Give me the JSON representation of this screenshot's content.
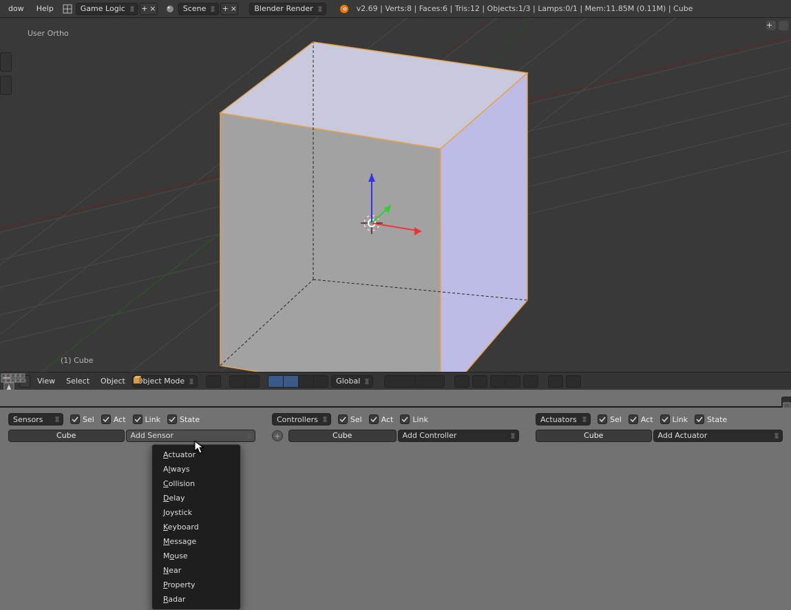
{
  "top": {
    "menus": [
      "dow",
      "Help"
    ],
    "screen_layout": "Game Logic",
    "scene": "Scene",
    "renderer": "Blender Render",
    "stats": "v2.69 | Verts:8 | Faces:6 | Tris:12 | Objects:1/3 | Lamps:0/1 | Mem:11.85M (0.11M) | Cube"
  },
  "viewport": {
    "top_label": "User Ortho",
    "bottom_label": "(1) Cube"
  },
  "view3d_header": {
    "menus": [
      "View",
      "Select",
      "Object"
    ],
    "mode": "Object Mode",
    "orientation": "Global"
  },
  "logic": {
    "sensors": {
      "type_label": "Sensors",
      "filters": [
        "Sel",
        "Act",
        "Link",
        "State"
      ],
      "object": "Cube",
      "add": "Add Sensor",
      "menu": [
        "Actuator",
        "Always",
        "Collision",
        "Delay",
        "Joystick",
        "Keyboard",
        "Message",
        "Mouse",
        "Near",
        "Property",
        "Radar"
      ]
    },
    "controllers": {
      "type_label": "Controllers",
      "filters": [
        "Sel",
        "Act",
        "Link"
      ],
      "object": "Cube",
      "add": "Add Controller"
    },
    "actuators": {
      "type_label": "Actuators",
      "filters": [
        "Sel",
        "Act",
        "Link",
        "State"
      ],
      "object": "Cube",
      "add": "Add Actuator"
    }
  }
}
